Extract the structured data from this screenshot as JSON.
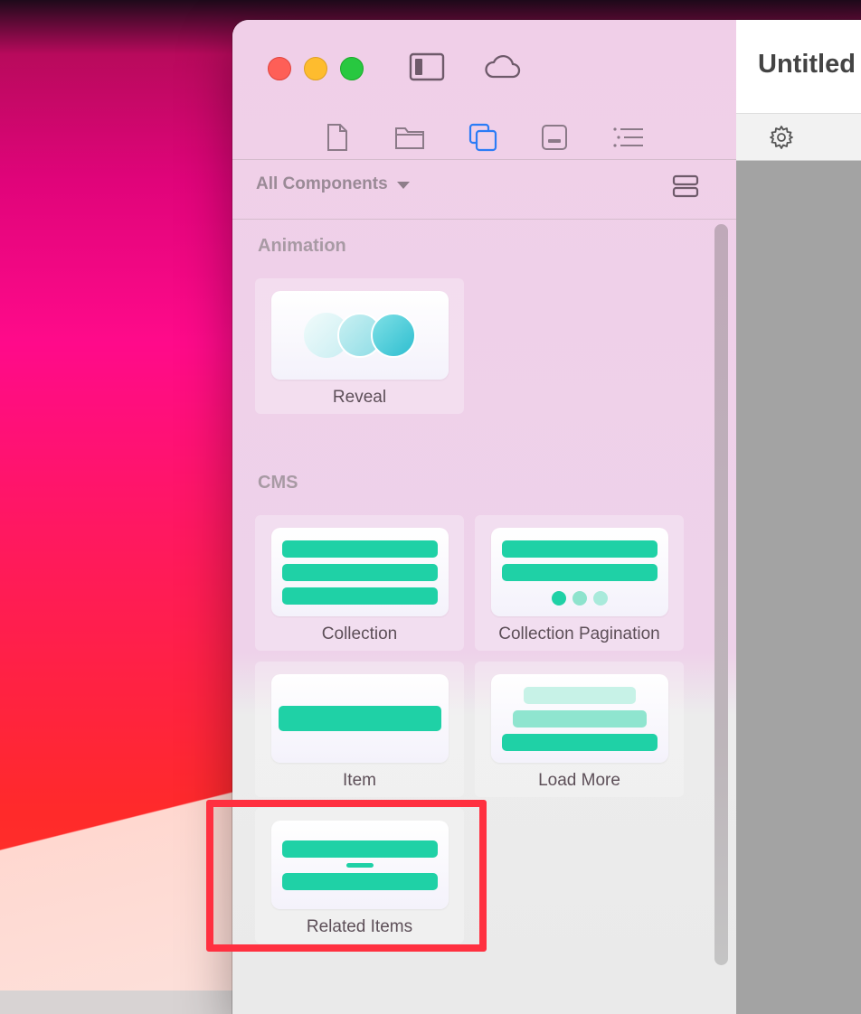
{
  "document": {
    "title": "Untitled"
  },
  "sidebar": {
    "filter_label": "All Components",
    "sections": [
      {
        "title": "Animation",
        "items": [
          {
            "label": "Reveal"
          }
        ]
      },
      {
        "title": "CMS",
        "items": [
          {
            "label": "Collection"
          },
          {
            "label": "Collection Pagination"
          },
          {
            "label": "Item"
          },
          {
            "label": "Load More"
          },
          {
            "label": "Related Items"
          }
        ]
      }
    ]
  },
  "toolbar_icons": [
    "sidebar-toggle-icon",
    "cloud-icon"
  ],
  "tab_icons": [
    "page-icon",
    "folder-icon",
    "components-icon",
    "media-icon",
    "outline-icon"
  ],
  "colors": {
    "accent": "#1fd1a6",
    "tab_active": "#2b7cf6",
    "highlight": "#ff3040"
  }
}
